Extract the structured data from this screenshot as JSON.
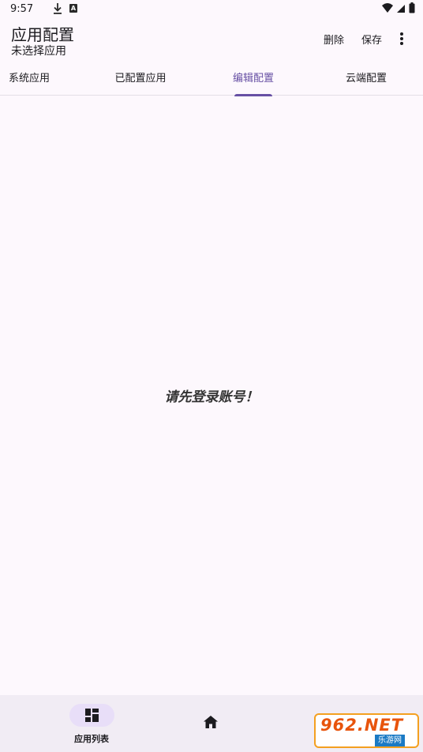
{
  "status_bar": {
    "time": "9:57",
    "icons": [
      "download-icon",
      "a-badge-icon",
      "wifi-icon",
      "signal-icon",
      "battery-icon"
    ],
    "a_badge": "A"
  },
  "app_bar": {
    "title": "应用配置",
    "subtitle": "未选择应用",
    "delete_label": "删除",
    "save_label": "保存"
  },
  "tabs": [
    {
      "label": "系统应用",
      "active": false
    },
    {
      "label": "已配置应用",
      "active": false
    },
    {
      "label": "编辑配置",
      "active": true
    },
    {
      "label": "云端配置",
      "active": false
    }
  ],
  "main": {
    "message": "请先登录账号！"
  },
  "bottom_nav": {
    "items": [
      {
        "label": "应用列表",
        "icon": "dashboard-icon",
        "active": true
      },
      {
        "label": "",
        "icon": "home-icon",
        "active": false
      }
    ]
  },
  "watermark": {
    "top": "962.NET",
    "bottom": "乐游网"
  },
  "colors": {
    "accent": "#6750a4",
    "background": "#fdf8fd",
    "nav_background": "#f1ecf4",
    "nav_pill": "#e8def8"
  }
}
